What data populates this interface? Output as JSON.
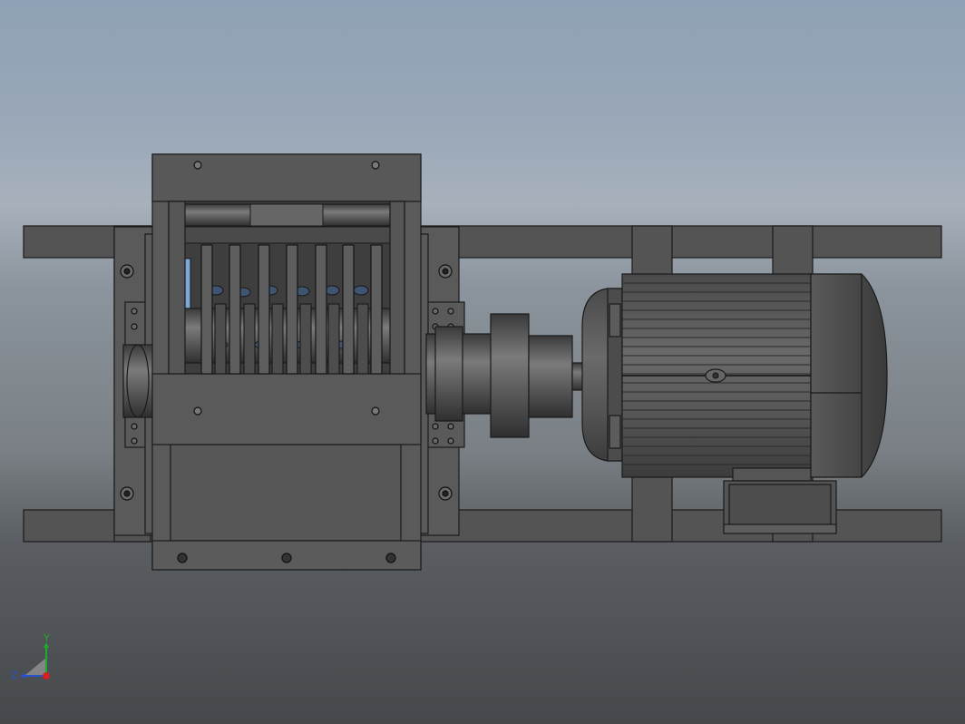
{
  "viewport": {
    "background_top": "#8fa1b6",
    "background_bottom": "#45494c"
  },
  "model": {
    "part_color": "#5a5a5a",
    "edge_color": "#1a1a1a",
    "highlight_color": "#7a7a7a",
    "glass_color": "#7ea7d6"
  },
  "triad": {
    "y_label": "Y",
    "z_label": "Z",
    "x_color": "#d42020",
    "y_color": "#1faa2a",
    "z_color": "#2a52c9"
  }
}
